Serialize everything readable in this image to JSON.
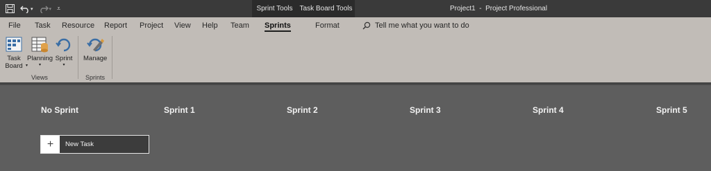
{
  "titlebar": {
    "context_tabs": [
      "Sprint Tools",
      "Task Board Tools"
    ],
    "app_title": "Project1  -  Project Professional"
  },
  "ribbon_tabs": [
    {
      "label": "File"
    },
    {
      "label": "Task"
    },
    {
      "label": "Resource"
    },
    {
      "label": "Report"
    },
    {
      "label": "Project"
    },
    {
      "label": "View"
    },
    {
      "label": "Help"
    },
    {
      "label": "Team"
    },
    {
      "label": "Sprints",
      "active": true
    },
    {
      "label": "Format"
    }
  ],
  "tell_me": {
    "placeholder": "Tell me what you want to do",
    "icon": "lightbulb-search-icon"
  },
  "ribbon": {
    "views_group": {
      "label": "Views",
      "buttons": [
        {
          "line1": "Task",
          "line2": "Board",
          "icon": "task-board-icon",
          "dropdown": true
        },
        {
          "line1": "Planning",
          "icon": "planning-icon",
          "dropdown": true
        },
        {
          "line1": "Sprint",
          "icon": "sprint-cycle-icon",
          "dropdown": true
        }
      ]
    },
    "sprints_group": {
      "label": "Sprints",
      "buttons": [
        {
          "line1": "Manage",
          "icon": "manage-sprints-icon"
        }
      ]
    }
  },
  "board": {
    "columns": [
      "No Sprint",
      "Sprint 1",
      "Sprint 2",
      "Sprint 3",
      "Sprint 4",
      "Sprint 5"
    ],
    "new_task_label": "New Task"
  },
  "colors": {
    "titlebar": "#3a3a3a",
    "ribbon": "#c1bcb7",
    "board_background": "#5e5e5e",
    "card_background": "#3c3c3c"
  }
}
